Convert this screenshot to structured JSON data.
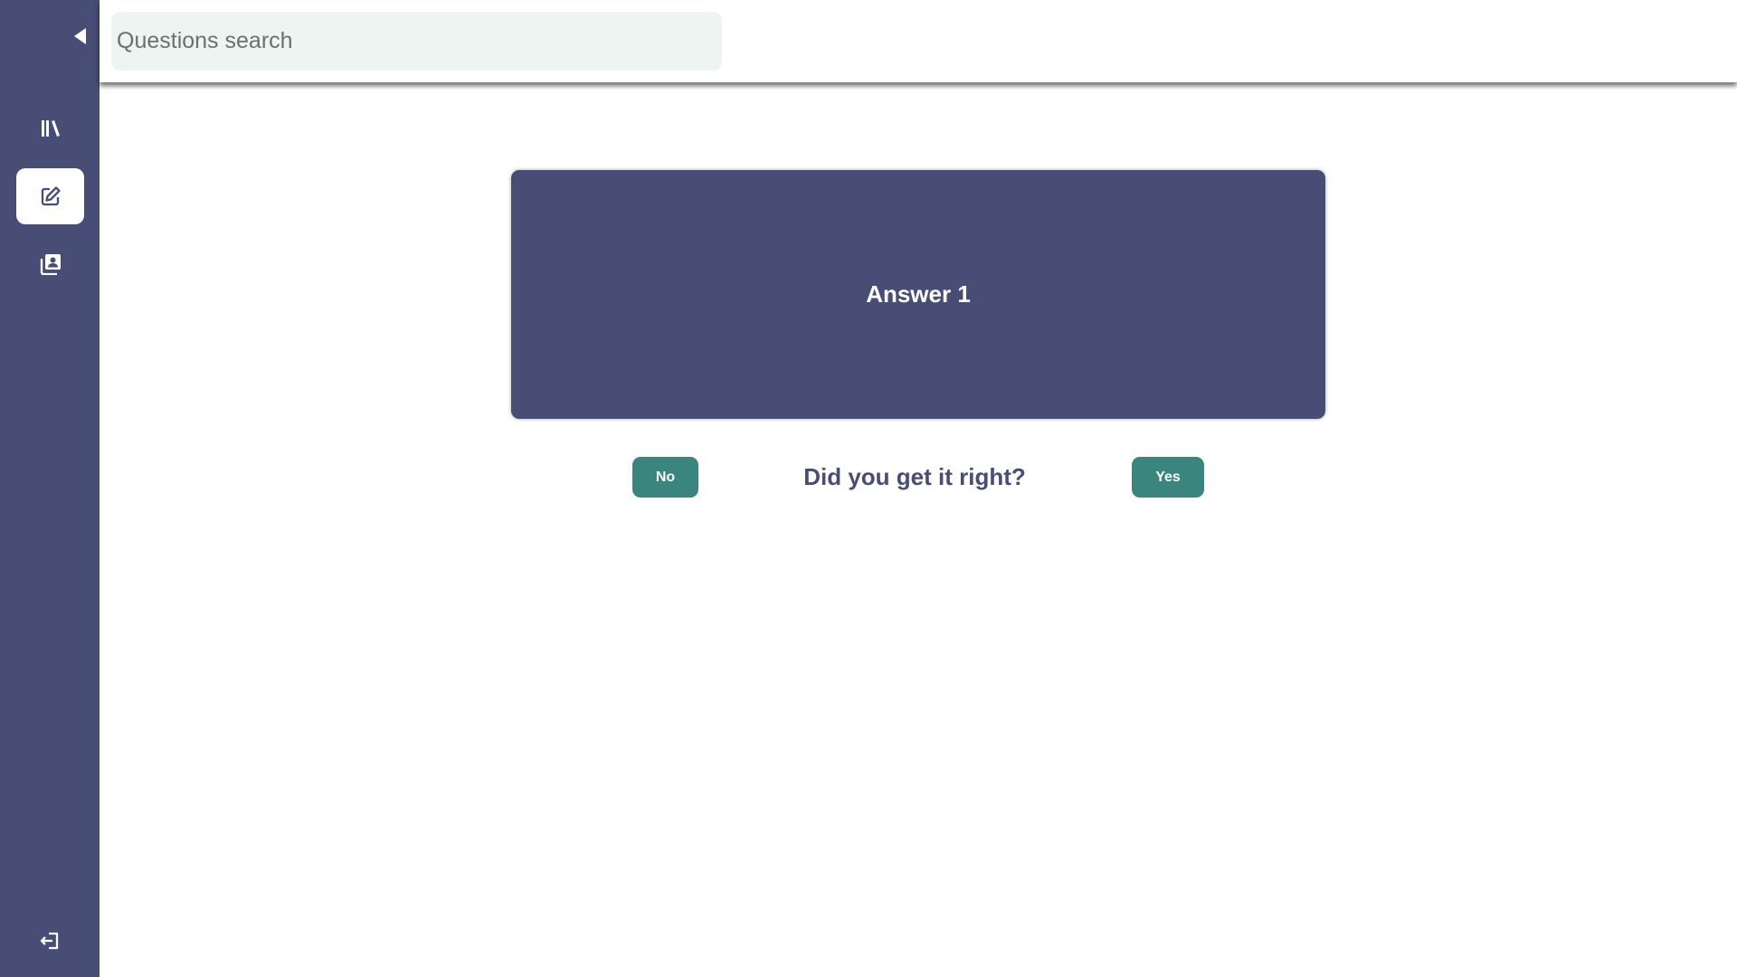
{
  "search": {
    "placeholder": "Questions search",
    "value": ""
  },
  "sidebar": {
    "collapse_icon": "caret-left-icon",
    "items": [
      {
        "name": "library",
        "icon": "books-icon",
        "active": false
      },
      {
        "name": "edit",
        "icon": "edit-square-icon",
        "active": true
      },
      {
        "name": "contacts",
        "icon": "contact-book-icon",
        "active": false
      }
    ],
    "logout_icon": "logout-icon"
  },
  "card": {
    "text": "Answer 1"
  },
  "answer": {
    "question": "Did you get it right?",
    "no_label": "No",
    "yes_label": "Yes"
  },
  "colors": {
    "sidebar_bg": "#474d75",
    "card_bg": "#474d75",
    "button_bg": "#3a857d",
    "search_bg": "#eef4f2"
  }
}
